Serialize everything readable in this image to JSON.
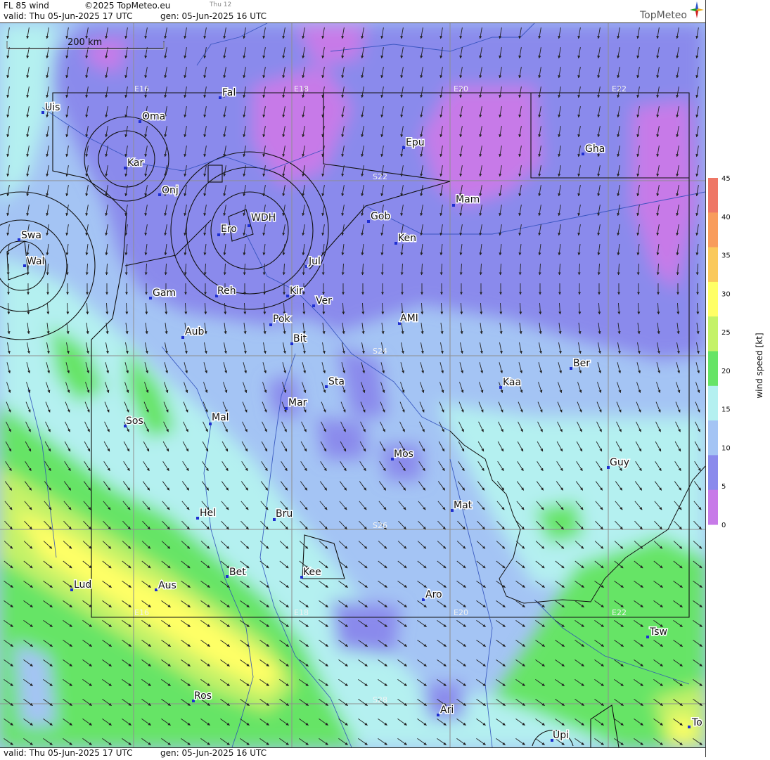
{
  "header": {
    "product": "FL 85 wind",
    "copyright": "©2025 TopMeteo.eu",
    "day_hint": "Thu 12",
    "valid": "valid:  Thu  05-Jun-2025  17 UTC",
    "gen": "gen: 05-Jun-2025 16 UTC",
    "brand": "TopMeteo"
  },
  "footer": {
    "valid": "valid:  Thu  05-Jun-2025  17 UTC",
    "gen": "gen: 05-Jun-2025 16 UTC"
  },
  "scale_bar": "200 km",
  "grid_labels": [
    "E16",
    "E18",
    "E20",
    "E22",
    "E16",
    "E18",
    "E20",
    "E22",
    "S22",
    "S24",
    "S26",
    "S28"
  ],
  "cities": [
    "Uis",
    "Oma",
    "Fal",
    "Epu",
    "Gha",
    "Kar",
    "Onj",
    "Mam",
    "Gob",
    "WDH",
    "Ero",
    "Ken",
    "Swa",
    "Wal",
    "Jul",
    "Gam",
    "Reh",
    "Kir",
    "Ver",
    "AMI",
    "Pok",
    "Aub",
    "Bit",
    "Ber",
    "Sta",
    "Kaa",
    "Mar",
    "Sos",
    "Mal",
    "Mos",
    "Guy",
    "Mat",
    "Hel",
    "Bru",
    "Bet",
    "Kee",
    "Lud",
    "Aus",
    "Aro",
    "Tsw",
    "Ros",
    "Ari",
    "Upi",
    "To"
  ],
  "legend": {
    "title": "wind  speed  [kt]",
    "ticks": [
      "45",
      "40",
      "35",
      "30",
      "25",
      "20",
      "15",
      "10",
      "5",
      "0"
    ],
    "colors": [
      "#ee7766",
      "#f89c5c",
      "#fac95c",
      "#ffff66",
      "#c4f268",
      "#66e466",
      "#b4f0f0",
      "#a4c4f4",
      "#8a8aec",
      "#c77ae8"
    ]
  }
}
